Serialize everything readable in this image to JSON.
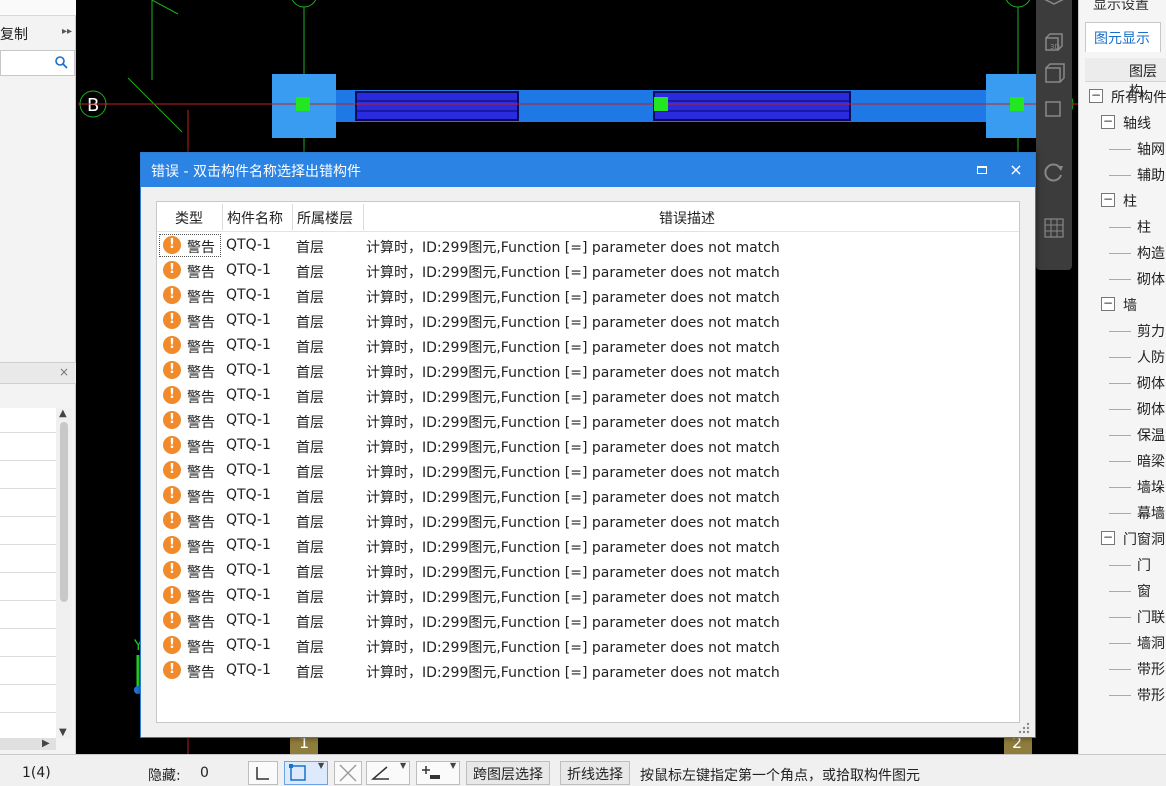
{
  "left_panel": {
    "copy_label": "复制",
    "more_arrow": "▸▸",
    "search_placeholder": "",
    "close_glyph": "×"
  },
  "canvas": {
    "axis_label_b": "B",
    "axis_label_1": "1",
    "axis_label_2": "2",
    "axis_label_y": "Y",
    "colors": {
      "beam_fill": "#1e78e6",
      "beam_inner": "#2a2adf",
      "endcap": "#3a9cf0",
      "node": "#22e622",
      "axis_green": "#1fae1f",
      "axis_red": "#c41e1e",
      "column_tan": "#8f7d3d"
    }
  },
  "view_toolbar": {
    "icons": [
      "cube-top-icon",
      "cube-3d-icon",
      "cube-front-icon",
      "cube-side-icon",
      "rotate-icon",
      "grid-view-icon"
    ],
    "label_3d": "3D"
  },
  "right_panel": {
    "title": "显示设置",
    "tab_label": "图元显示",
    "tree_header": "图层构",
    "tree": [
      {
        "label": "所有构件",
        "level": 0,
        "toggle": "−"
      },
      {
        "label": "轴线",
        "level": 1,
        "toggle": "−"
      },
      {
        "label": "轴网",
        "level": 2
      },
      {
        "label": "辅助",
        "level": 2
      },
      {
        "label": "柱",
        "level": 1,
        "toggle": "−"
      },
      {
        "label": "柱",
        "level": 2
      },
      {
        "label": "构造",
        "level": 2
      },
      {
        "label": "砌体",
        "level": 2
      },
      {
        "label": "墙",
        "level": 1,
        "toggle": "−"
      },
      {
        "label": "剪力",
        "level": 2
      },
      {
        "label": "人防",
        "level": 2
      },
      {
        "label": "砌体",
        "level": 2
      },
      {
        "label": "砌体",
        "level": 2
      },
      {
        "label": "保温",
        "level": 2
      },
      {
        "label": "暗梁",
        "level": 2
      },
      {
        "label": "墙垛",
        "level": 2
      },
      {
        "label": "幕墙",
        "level": 2
      },
      {
        "label": "门窗洞",
        "level": 1,
        "toggle": "−"
      },
      {
        "label": "门",
        "level": 2
      },
      {
        "label": "窗",
        "level": 2
      },
      {
        "label": "门联",
        "level": 2
      },
      {
        "label": "墙洞",
        "level": 2
      },
      {
        "label": "带形",
        "level": 2
      },
      {
        "label": "带形",
        "level": 2
      }
    ]
  },
  "dialog": {
    "title": "错误 - 双击构件名称选择出错构件",
    "close_glyph": "×",
    "columns": [
      "类型",
      "构件名称",
      "所属楼层",
      "错误描述"
    ],
    "warn_glyph": "!",
    "rows": [
      {
        "type": "警告",
        "name": "QTQ-1",
        "floor": "首层",
        "desc": "计算时，ID:299图元,Function [=] parameter does not match"
      },
      {
        "type": "警告",
        "name": "QTQ-1",
        "floor": "首层",
        "desc": "计算时，ID:299图元,Function [=] parameter does not match"
      },
      {
        "type": "警告",
        "name": "QTQ-1",
        "floor": "首层",
        "desc": "计算时，ID:299图元,Function [=] parameter does not match"
      },
      {
        "type": "警告",
        "name": "QTQ-1",
        "floor": "首层",
        "desc": "计算时，ID:299图元,Function [=] parameter does not match"
      },
      {
        "type": "警告",
        "name": "QTQ-1",
        "floor": "首层",
        "desc": "计算时，ID:299图元,Function [=] parameter does not match"
      },
      {
        "type": "警告",
        "name": "QTQ-1",
        "floor": "首层",
        "desc": "计算时，ID:299图元,Function [=] parameter does not match"
      },
      {
        "type": "警告",
        "name": "QTQ-1",
        "floor": "首层",
        "desc": "计算时，ID:299图元,Function [=] parameter does not match"
      },
      {
        "type": "警告",
        "name": "QTQ-1",
        "floor": "首层",
        "desc": "计算时，ID:299图元,Function [=] parameter does not match"
      },
      {
        "type": "警告",
        "name": "QTQ-1",
        "floor": "首层",
        "desc": "计算时，ID:299图元,Function [=] parameter does not match"
      },
      {
        "type": "警告",
        "name": "QTQ-1",
        "floor": "首层",
        "desc": "计算时，ID:299图元,Function [=] parameter does not match"
      },
      {
        "type": "警告",
        "name": "QTQ-1",
        "floor": "首层",
        "desc": "计算时，ID:299图元,Function [=] parameter does not match"
      },
      {
        "type": "警告",
        "name": "QTQ-1",
        "floor": "首层",
        "desc": "计算时，ID:299图元,Function [=] parameter does not match"
      },
      {
        "type": "警告",
        "name": "QTQ-1",
        "floor": "首层",
        "desc": "计算时，ID:299图元,Function [=] parameter does not match"
      },
      {
        "type": "警告",
        "name": "QTQ-1",
        "floor": "首层",
        "desc": "计算时，ID:299图元,Function [=] parameter does not match"
      },
      {
        "type": "警告",
        "name": "QTQ-1",
        "floor": "首层",
        "desc": "计算时，ID:299图元,Function [=] parameter does not match"
      },
      {
        "type": "警告",
        "name": "QTQ-1",
        "floor": "首层",
        "desc": "计算时，ID:299图元,Function [=] parameter does not match"
      },
      {
        "type": "警告",
        "name": "QTQ-1",
        "floor": "首层",
        "desc": "计算时，ID:299图元,Function [=] parameter does not match"
      },
      {
        "type": "警告",
        "name": "QTQ-1",
        "floor": "首层",
        "desc": "计算时，ID:299图元,Function [=] parameter does not match"
      }
    ],
    "colors": {
      "titlebar": "#2b84e4",
      "warn_icon": "#f08a2a"
    }
  },
  "statusbar": {
    "page": "1(4)",
    "hidden_label": "隐藏:",
    "hidden_count": "0",
    "cross_layer_select": "跨图层选择",
    "polyline_select": "折线选择",
    "hint": "按鼠标左键指定第一个角点，或拾取构件图元"
  }
}
